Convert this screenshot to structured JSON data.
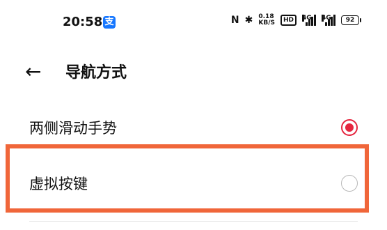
{
  "status_bar": {
    "time": "20:58",
    "app_icon": "alipay-icon",
    "nfc": "N",
    "bluetooth": "✱",
    "speed_value": "0.18",
    "speed_unit": "KB/S",
    "hd": "HD",
    "net1": "4G",
    "net2": "4G",
    "battery": "92"
  },
  "header": {
    "back_icon": "arrow-left-icon",
    "title": "导航方式"
  },
  "options": [
    {
      "label": "两侧滑动手势",
      "selected": true
    },
    {
      "label": "虚拟按键",
      "selected": false
    }
  ],
  "colors": {
    "accent": "#e5263f",
    "highlight": "#f0663a",
    "alipay": "#1677ff"
  }
}
